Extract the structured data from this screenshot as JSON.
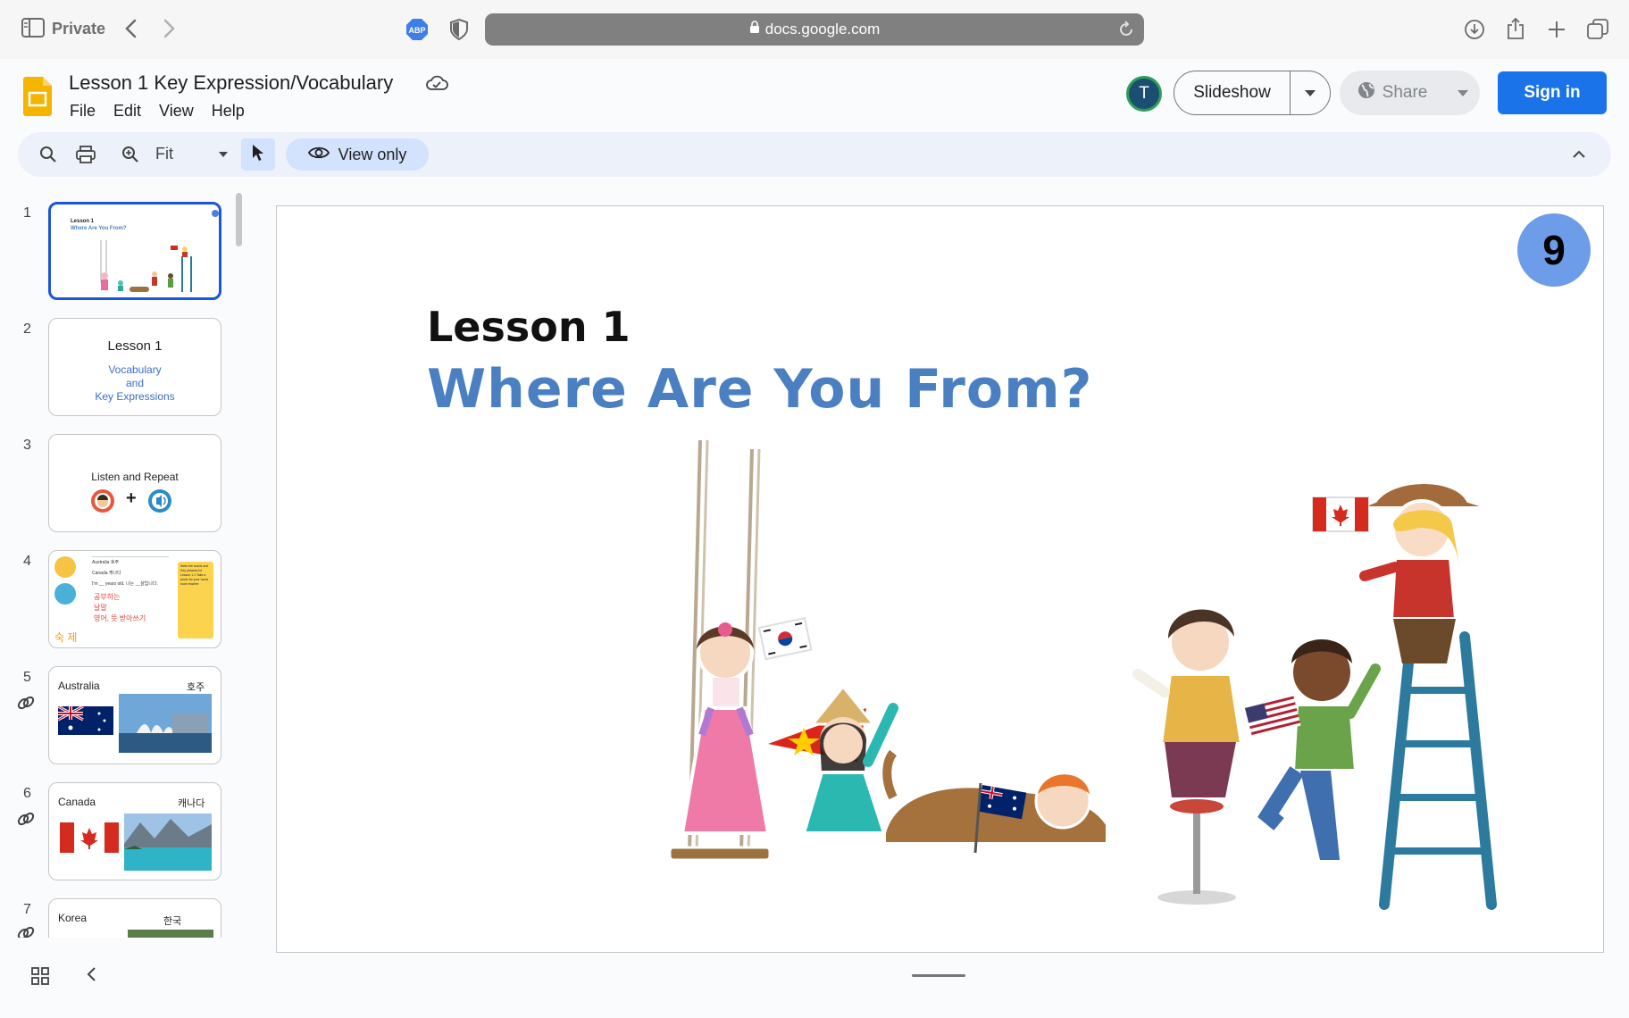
{
  "browser": {
    "mode_label": "Private",
    "url": "docs.google.com",
    "extension_label": "ABP"
  },
  "doc": {
    "title": "Lesson 1 Key Expression/Vocabulary",
    "menu": [
      "File",
      "Edit",
      "View",
      "Help"
    ],
    "avatar_initial": "T",
    "slideshow_label": "Slideshow",
    "share_label": "Share",
    "signin_label": "Sign in"
  },
  "toolbar": {
    "zoom_value": "Fit",
    "view_only_label": "View only"
  },
  "filmstrip": {
    "slides": [
      {
        "num": "1",
        "title": "Lesson 1",
        "subtitle": "Where Are You From?"
      },
      {
        "num": "2",
        "title": "Lesson 1",
        "lines": [
          "Vocabulary",
          "and",
          "Key Expressions"
        ]
      },
      {
        "num": "3",
        "title": "Listen and Repeat",
        "plus": "+"
      },
      {
        "num": "4",
        "rows": [
          "Australia  호주",
          "Canada  캐나다",
          "I'm __ years old.  나는 __살입니다."
        ],
        "red_lines": [
          "공부하는",
          "날말",
          "영어, 뜻 받아쓰기"
        ],
        "homework": "숙 제",
        "note": "Write the words and Key phrases for Lesson 1.1 Take a photo for your home room teacher"
      },
      {
        "num": "5",
        "country": "Australia",
        "korean": "호주"
      },
      {
        "num": "6",
        "country": "Canada",
        "korean": "캐나다"
      },
      {
        "num": "7",
        "country": "Korea",
        "korean": "한국"
      }
    ]
  },
  "slide": {
    "heading": "Lesson 1",
    "question": "Where Are You From?",
    "page_number": "9"
  },
  "colors": {
    "accent_blue": "#1a73e8",
    "slide_title_blue": "#4a7fc1",
    "badge_blue": "#6d9ce8",
    "toolbar_bg": "#edf2fa"
  },
  "icons": [
    "sidebar-icon",
    "back-arrow-icon",
    "forward-arrow-icon",
    "shield-icon",
    "lock-icon",
    "reload-icon",
    "download-icon",
    "share-icon",
    "plus-icon",
    "tabs-icon",
    "cloud-icon",
    "globe-icon",
    "search-icon",
    "print-icon",
    "zoom-icon",
    "cursor-icon",
    "eye-icon",
    "chevron-up-icon",
    "link-icon",
    "grid-icon",
    "chevron-left-icon"
  ]
}
